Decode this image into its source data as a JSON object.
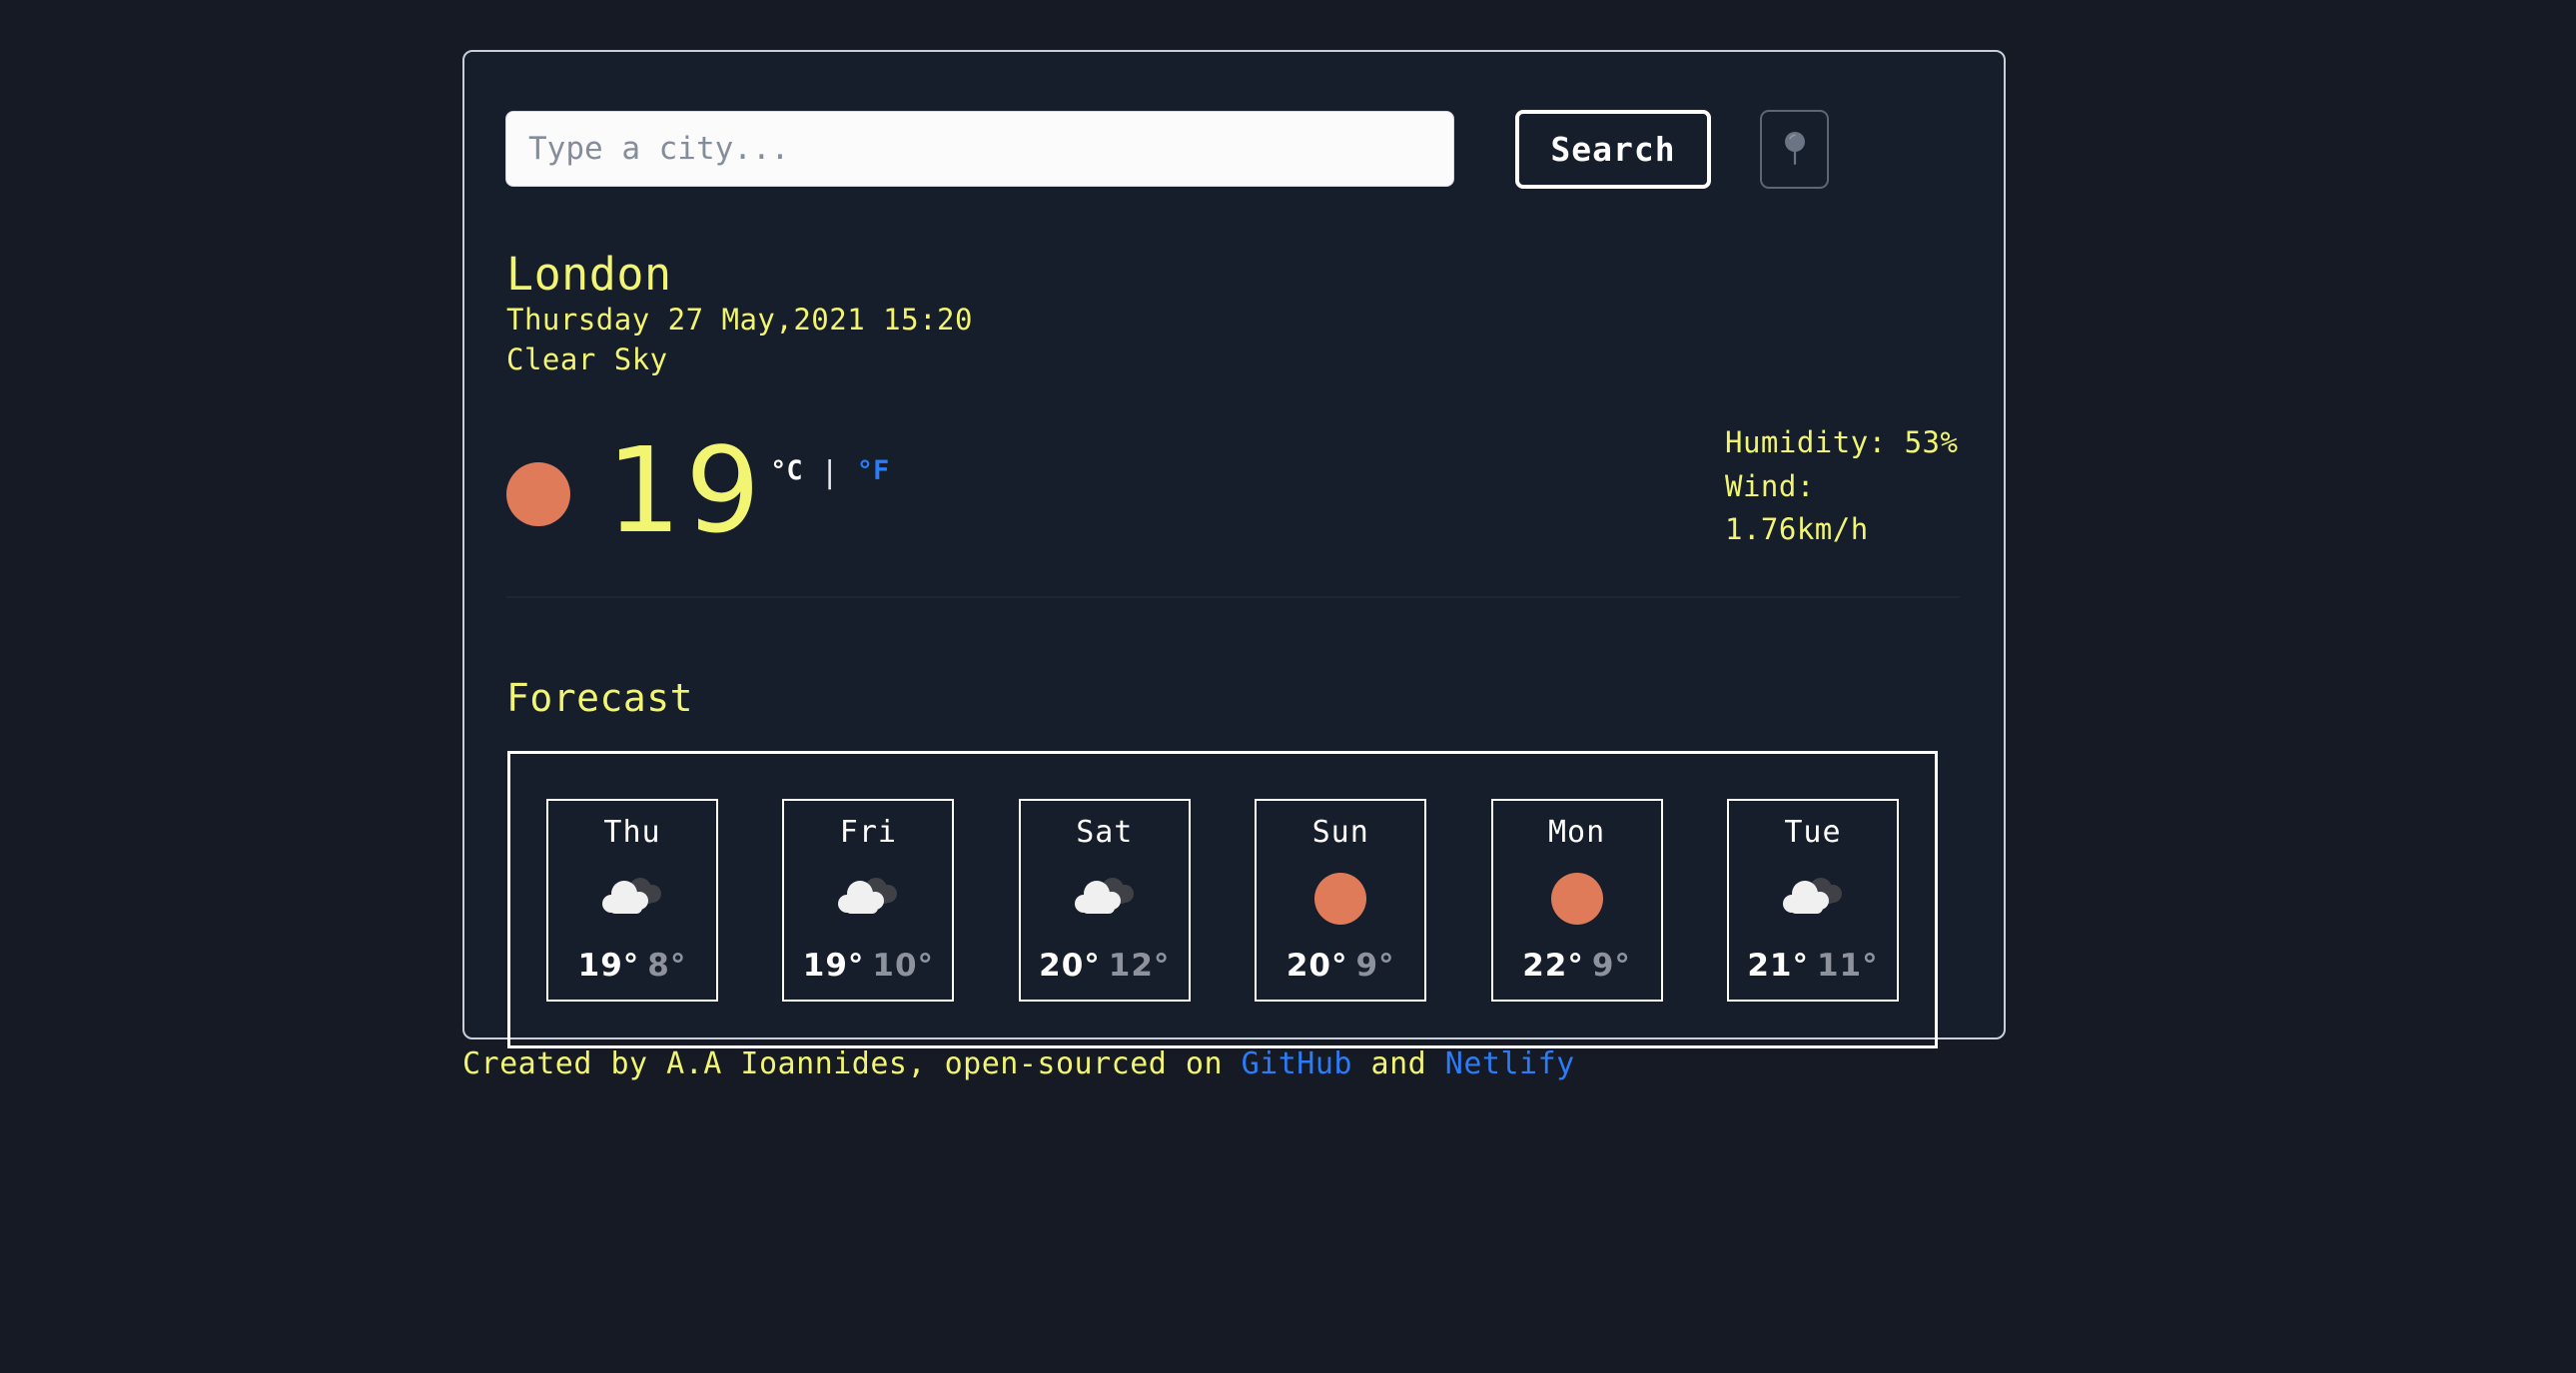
{
  "search": {
    "placeholder": "Type a city...",
    "value": "",
    "search_label": "Search",
    "geolocate_icon": "location-pin-icon"
  },
  "current": {
    "city": "London",
    "datetime": "Thursday 27 May,2021 15:20",
    "description": "Clear Sky",
    "icon": "sun-icon",
    "temperature": "19",
    "unit_active": "°C",
    "unit_separator": "|",
    "unit_inactive": "°F",
    "humidity": "Humidity: 53%",
    "wind": "Wind: 1.76km/h"
  },
  "forecast": {
    "title": "Forecast",
    "days": [
      {
        "day": "Thu",
        "icon": "cloud-icon",
        "max": "19°",
        "min": "8°"
      },
      {
        "day": "Fri",
        "icon": "cloud-icon",
        "max": "19°",
        "min": "10°"
      },
      {
        "day": "Sat",
        "icon": "cloud-icon",
        "max": "20°",
        "min": "12°"
      },
      {
        "day": "Sun",
        "icon": "sun-icon",
        "max": "20°",
        "min": "9°"
      },
      {
        "day": "Mon",
        "icon": "sun-icon",
        "max": "22°",
        "min": "9°"
      },
      {
        "day": "Tue",
        "icon": "cloud-icon",
        "max": "21°",
        "min": "11°"
      }
    ]
  },
  "footer": {
    "prefix": "Created by A.A Ioannides, open-sourced on ",
    "link1": "GitHub",
    "middle": " and ",
    "link2": "Netlify"
  },
  "colors": {
    "page_background": "#151a24",
    "card_background": "#171e2b",
    "accent_yellow": "#f2f571",
    "link_blue": "#2b7cf6",
    "sun_orange": "#e07b5a",
    "cloud_light": "#f0f0f0",
    "cloud_dark": "#3f4147",
    "border_white": "#ffffff"
  }
}
